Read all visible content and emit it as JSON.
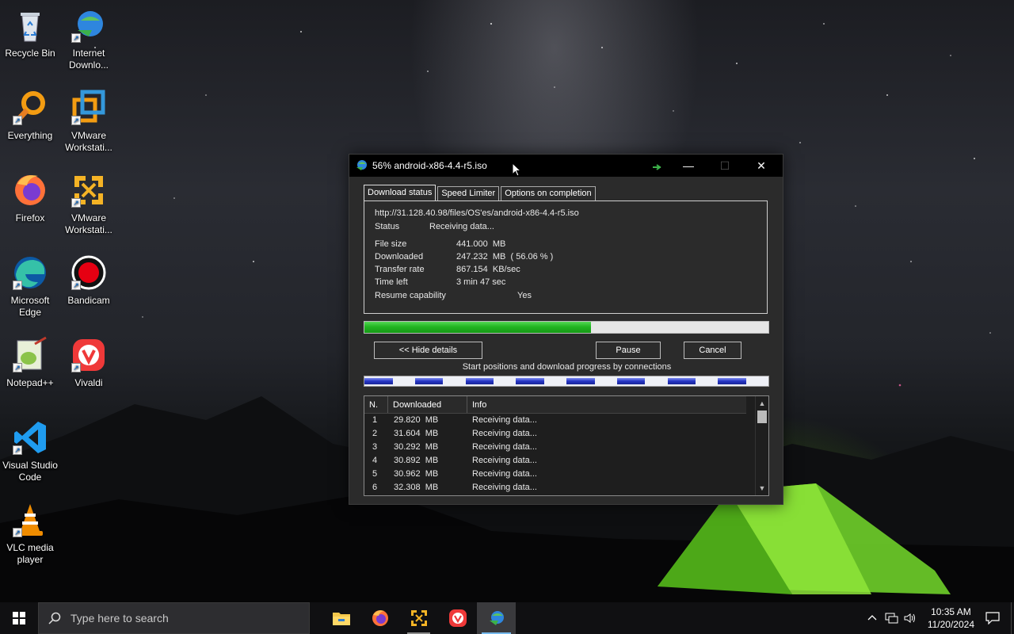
{
  "desktop": {
    "icons": [
      {
        "label": "Recycle Bin",
        "icon": "recycle-bin-icon"
      },
      {
        "label": "Internet Downlo...",
        "icon": "idm-icon"
      },
      {
        "label": "Everything",
        "icon": "everything-icon"
      },
      {
        "label": "VMware Workstati...",
        "icon": "vmware-icon"
      },
      {
        "label": "Firefox",
        "icon": "firefox-icon"
      },
      {
        "label": "VMware Workstati...",
        "icon": "vmware-player-icon"
      },
      {
        "label": "Microsoft Edge",
        "icon": "edge-icon"
      },
      {
        "label": "Bandicam",
        "icon": "bandicam-icon"
      },
      {
        "label": "Notepad++",
        "icon": "notepadpp-icon"
      },
      {
        "label": "Vivaldi",
        "icon": "vivaldi-icon"
      },
      {
        "label": "Visual Studio Code",
        "icon": "vscode-icon"
      },
      {
        "label": "VLC media player",
        "icon": "vlc-icon"
      }
    ]
  },
  "idm_window": {
    "title": "56% android-x86-4.4-r5.iso",
    "controls": {
      "minimize": "—",
      "maximize": "☐",
      "close": "✕"
    },
    "tabs": [
      "Download status",
      "Speed Limiter",
      "Options on completion"
    ],
    "url": "http://31.128.40.98/files/OS'es/android-x86-4.4-r5.iso",
    "status_label": "Status",
    "status_value": "Receiving data...",
    "file_size_label": "File size",
    "file_size_value": "441.000  MB",
    "downloaded_label": "Downloaded",
    "downloaded_value": "247.232  MB  ( 56.06 % )",
    "transfer_rate_label": "Transfer rate",
    "transfer_rate_value": "867.154  KB/sec",
    "time_left_label": "Time left",
    "time_left_value": "3 min 47 sec",
    "resume_label": "Resume capability",
    "resume_value": "Yes",
    "progress_fraction": 0.5606,
    "hide_details_label": "<< Hide details",
    "pause_label": "Pause",
    "cancel_label": "Cancel",
    "connections_caption": "Start positions and download progress by connections",
    "connection_fractions": [
      0.56,
      0.56,
      0.56,
      0.56,
      0.56,
      0.56,
      0.56,
      0.56
    ],
    "table": {
      "columns": [
        "N.",
        "Downloaded",
        "Info"
      ],
      "rows": [
        {
          "n": "1",
          "downloaded": "29.820  MB",
          "info": "Receiving data..."
        },
        {
          "n": "2",
          "downloaded": "31.604  MB",
          "info": "Receiving data..."
        },
        {
          "n": "3",
          "downloaded": "30.292  MB",
          "info": "Receiving data..."
        },
        {
          "n": "4",
          "downloaded": "30.892  MB",
          "info": "Receiving data..."
        },
        {
          "n": "5",
          "downloaded": "30.962  MB",
          "info": "Receiving data..."
        },
        {
          "n": "6",
          "downloaded": "32.308  MB",
          "info": "Receiving data..."
        }
      ]
    }
  },
  "taskbar": {
    "search_placeholder": "Type here to search",
    "apps": [
      "file-explorer-icon",
      "firefox-icon",
      "vmware-icon",
      "vivaldi-icon",
      "idm-icon"
    ],
    "time": "10:35 AM",
    "date": "11/20/2024"
  },
  "colors": {
    "progress_green": "#22b522",
    "connection_blue": "#2535c4",
    "taskbar": "#101012"
  }
}
